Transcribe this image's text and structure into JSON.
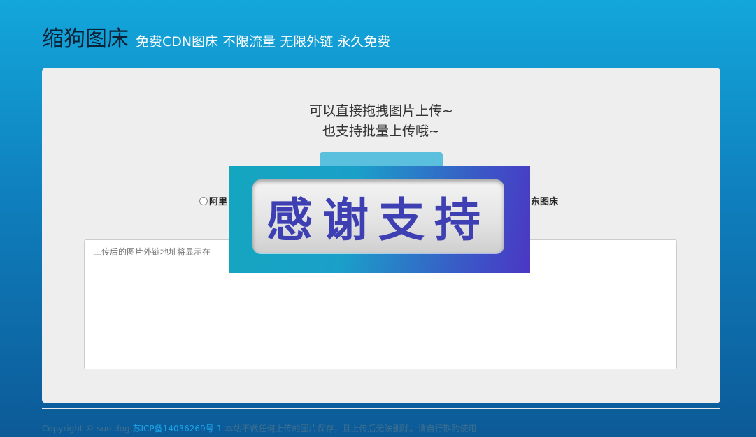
{
  "header": {
    "title": "缩狗图床",
    "tagline": "免费CDN图床 不限流量 无限外链 永久免费"
  },
  "panel": {
    "drop_hint_line1": "可以直接拖拽图片上传~",
    "drop_hint_line2": "也支持批量上传哦~",
    "upload_button_label": "",
    "host_options": [
      "阿里",
      "东图床"
    ],
    "result_placeholder": "上传后的图片外链地址将显示在"
  },
  "overlay": {
    "text": "感谢支持"
  },
  "footer": {
    "copyright": "Copyright © suo.dog ",
    "icp": "苏ICP备14036269号-1",
    "notice": " 本站不做任何上传的图片保存，且上传后无法删除。请自行斟酌使用"
  },
  "colors": {
    "accent": "#5bc0de",
    "banner_text": "#3d3fb2"
  }
}
